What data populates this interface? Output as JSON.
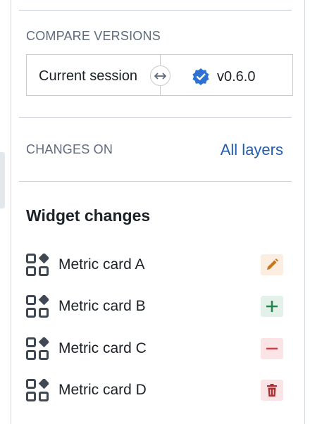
{
  "compare": {
    "section_label": "COMPARE VERSIONS",
    "left_label": "Current session",
    "right_label": "v0.6.0",
    "swap_icon": "swap-horizontal-icon",
    "verified_icon": "verified-badge-icon"
  },
  "changes_on": {
    "label": "CHANGES ON",
    "selector_label": "All layers"
  },
  "widget_changes": {
    "heading": "Widget changes",
    "items": [
      {
        "label": "Metric card A",
        "change": "edited",
        "icon": "pencil-icon"
      },
      {
        "label": "Metric card B",
        "change": "added",
        "icon": "plus-icon"
      },
      {
        "label": "Metric card C",
        "change": "removed",
        "icon": "minus-icon"
      },
      {
        "label": "Metric card D",
        "change": "deleted",
        "icon": "trash-icon"
      }
    ]
  },
  "colors": {
    "link": "#215db0",
    "edit": "#c87619",
    "add": "#238551",
    "remove": "#cd4246",
    "delete": "#ac2f33",
    "verified": "#2d72d2"
  }
}
